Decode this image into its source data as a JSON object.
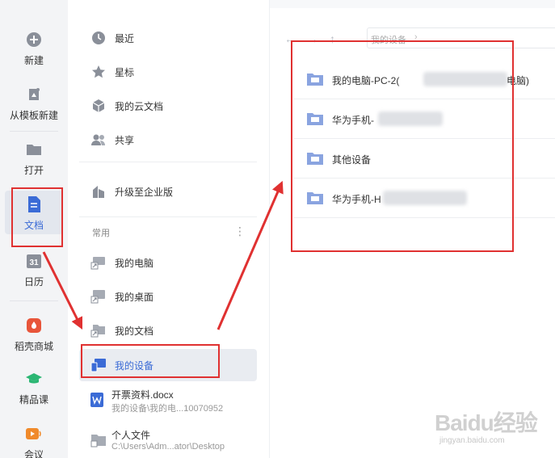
{
  "rail": {
    "items": [
      {
        "label": "新建",
        "icon": "plus-circle-icon"
      },
      {
        "label": "从模板新建",
        "icon": "template-icon"
      },
      {
        "label": "打开",
        "icon": "folder-icon"
      },
      {
        "label": "文档",
        "icon": "document-icon"
      },
      {
        "label": "日历",
        "icon": "calendar-icon",
        "badge": "31"
      },
      {
        "label": "稻壳商城",
        "icon": "docer-store-icon"
      },
      {
        "label": "精品课",
        "icon": "graduation-cap-icon"
      },
      {
        "label": "会议",
        "icon": "meeting-icon"
      }
    ]
  },
  "nav": {
    "recent": "最近",
    "starred": "星标",
    "cloud_docs": "我的云文档",
    "shared": "共享",
    "upgrade": "升级至企业版",
    "section_label": "常用",
    "section_more": "⋮",
    "my_computer": "我的电脑",
    "my_desktop": "我的桌面",
    "my_documents": "我的文档",
    "my_devices": "我的设备"
  },
  "files": [
    {
      "name": "开票资料.docx",
      "path": "我的设备\\我的电...10070952"
    },
    {
      "name": "个人文件",
      "path": "C:\\Users\\Adm...ator\\Desktop"
    }
  ],
  "toolbar": {
    "back": "←",
    "forward": "→",
    "up": "↑",
    "breadcrumb": "我的设备",
    "breadcrumb_sep": "›"
  },
  "devices": [
    {
      "label_start": "我的电脑-PC-2(",
      "label_end": "电脑)"
    },
    {
      "label_start": "华为手机-",
      "label_end": ""
    },
    {
      "label_start": "其他设备",
      "label_end": ""
    },
    {
      "label_start": "华为手机-H",
      "label_end": ""
    }
  ],
  "watermark": {
    "brand": "Baidu经验",
    "url": "jingyan.baidu.com"
  },
  "colors": {
    "accent": "#3b6bd6",
    "annotation": "#e03131",
    "folder": "#8aa4e0"
  }
}
